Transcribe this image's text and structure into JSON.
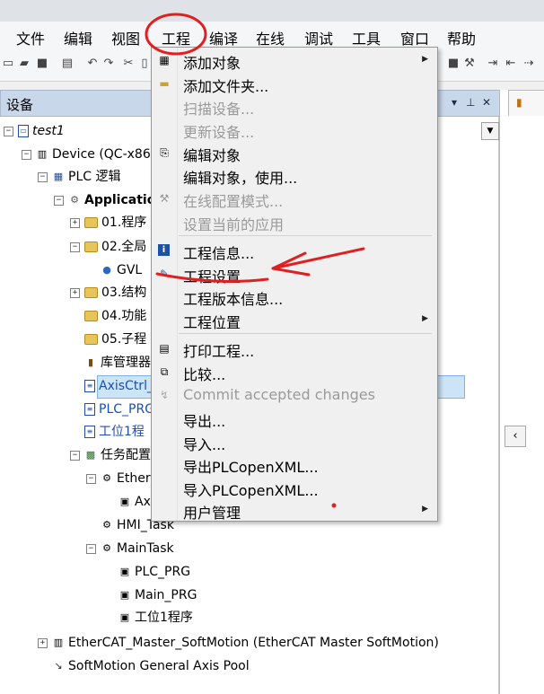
{
  "menubar": [
    "文件",
    "编辑",
    "视图",
    "工程",
    "编译",
    "在线",
    "调试",
    "工具",
    "窗口",
    "帮助"
  ],
  "panel": {
    "title": "设备"
  },
  "tree": {
    "root": "test1",
    "device": "Device (QC-x86-",
    "plc": "PLC 逻辑",
    "app": "Applicatio",
    "n01": "01.程序",
    "n02": "02.全局",
    "gvl": "GVL",
    "n03": "03.结构",
    "n04": "04.功能",
    "n05": "05.子程",
    "lib": "库管理器",
    "axisctrl": "AxisCtrl_",
    "plcprg": "PLC_PRG",
    "gw1": "工位1程",
    "taskcfg": "任务配置",
    "ether": "Ether",
    "ax": "Ax",
    "hmi": "HMI_Task",
    "maintask": "MainTask",
    "m_plcprg": "PLC_PRG",
    "m_main": "Main_PRG",
    "m_gw1": "工位1程序",
    "ecat": "EtherCAT_Master_SoftMotion (EtherCAT Master SoftMotion)",
    "pool": "SoftMotion General Axis Pool"
  },
  "menu": {
    "items": [
      {
        "label": "添加对象",
        "disabled": false,
        "submenu": true
      },
      {
        "label": "添加文件夹...",
        "disabled": false,
        "submenu": false
      },
      {
        "label": "扫描设备...",
        "disabled": true,
        "submenu": false
      },
      {
        "label": "更新设备...",
        "disabled": true,
        "submenu": false
      },
      {
        "label": "编辑对象",
        "disabled": false,
        "submenu": false
      },
      {
        "label": "编辑对象，使用...",
        "disabled": false,
        "submenu": false
      },
      {
        "label": "在线配置模式...",
        "disabled": true,
        "submenu": false
      },
      {
        "label": "设置当前的应用",
        "disabled": true,
        "submenu": false
      },
      {
        "label": "工程信息...",
        "disabled": false,
        "submenu": false
      },
      {
        "label": "工程设置...",
        "disabled": false,
        "submenu": false
      },
      {
        "label": "工程版本信息...",
        "disabled": false,
        "submenu": false
      },
      {
        "label": "工程位置",
        "disabled": false,
        "submenu": true
      },
      {
        "label": "打印工程...",
        "disabled": false,
        "submenu": false
      },
      {
        "label": "比较...",
        "disabled": false,
        "submenu": false
      },
      {
        "label": "Commit accepted changes",
        "disabled": true,
        "submenu": false
      },
      {
        "label": "导出...",
        "disabled": false,
        "submenu": false
      },
      {
        "label": "导入...",
        "disabled": false,
        "submenu": false
      },
      {
        "label": "导出PLCopenXML...",
        "disabled": false,
        "submenu": false
      },
      {
        "label": "导入PLCopenXML...",
        "disabled": false,
        "submenu": false
      },
      {
        "label": "用户管理",
        "disabled": false,
        "submenu": true
      }
    ]
  },
  "colors": {
    "annotation": "#e02020",
    "selection": "#cce4f7",
    "panel_header": "#c9d7ea"
  }
}
